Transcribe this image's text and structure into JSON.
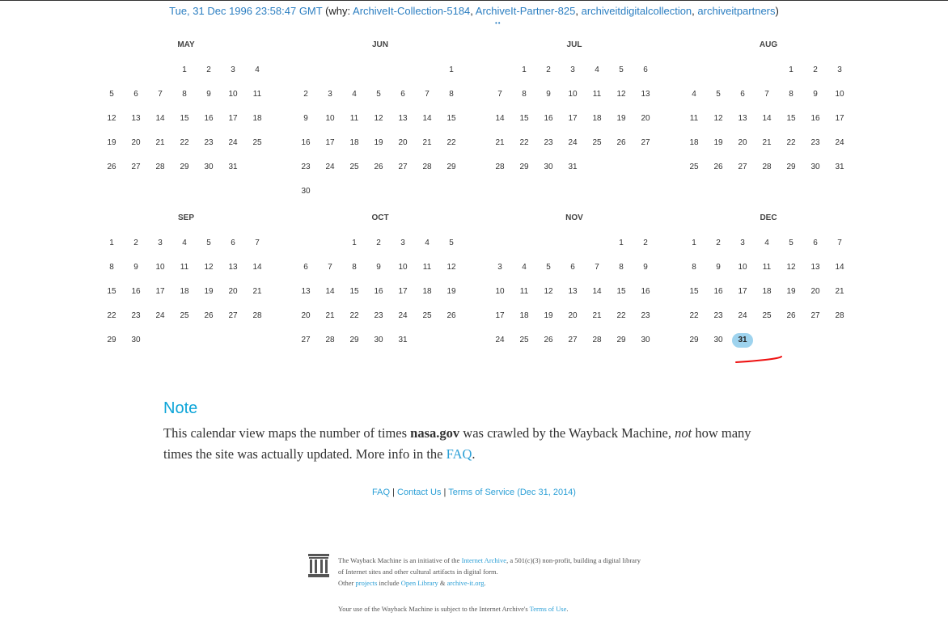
{
  "capture": {
    "timestamp": "Tue, 31 Dec 1996 23:58:47 GMT",
    "why_open": " (why: ",
    "reasons": [
      "ArchiveIt-Collection-5184",
      "ArchiveIt-Partner-825",
      "archiveitdigitalcollection",
      "archiveitpartners"
    ],
    "sep": ", ",
    "why_close": ")",
    "dots": "••"
  },
  "calendar": {
    "year": 1996,
    "highlight_color": "#9ed3ee",
    "months": [
      {
        "name": "MAY",
        "first_dow": 3,
        "days": 31
      },
      {
        "name": "JUN",
        "first_dow": 6,
        "days": 30
      },
      {
        "name": "JUL",
        "first_dow": 1,
        "days": 31
      },
      {
        "name": "AUG",
        "first_dow": 4,
        "days": 31
      },
      {
        "name": "SEP",
        "first_dow": 0,
        "days": 30
      },
      {
        "name": "OCT",
        "first_dow": 2,
        "days": 31
      },
      {
        "name": "NOV",
        "first_dow": 5,
        "days": 30
      },
      {
        "name": "DEC",
        "first_dow": 0,
        "days": 31,
        "captured_days": [
          31
        ]
      }
    ]
  },
  "note": {
    "heading": "Note",
    "text_1": "This calendar view maps the number of times ",
    "site": "nasa.gov",
    "text_2": " was crawled by the Wayback Machine, ",
    "emphasis": "not",
    "text_3": " how many times the site was actually updated. More info in the ",
    "faq_link": "FAQ",
    "text_4": "."
  },
  "bottom_links": {
    "faq": "FAQ",
    "sep": " | ",
    "contact": "Contact Us",
    "terms": "Terms of Service (Dec 31, 2014)"
  },
  "footer": {
    "logo_icon": "internet-archive-building-icon",
    "t1": "The Wayback Machine is an initiative of the ",
    "ia_link": "Internet Archive",
    "t2": ", a 501(c)(3) non-profit, building a digital library of Internet sites and other cultural artifacts in digital form.",
    "t3": "Other ",
    "projects_link": "projects",
    "t4": " include ",
    "ol_link": "Open Library",
    "t5": " & ",
    "ait_link": "archive-it.org",
    "t6": ".",
    "terms_text": "Your use of the Wayback Machine is subject to the Internet Archive's ",
    "terms_link": "Terms of Use",
    "terms_end": "."
  }
}
